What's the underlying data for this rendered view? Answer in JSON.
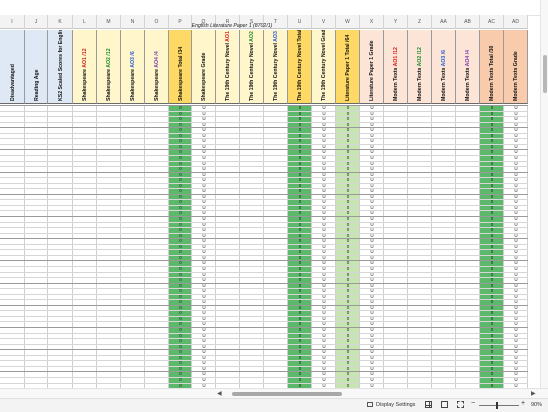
{
  "sheet_title": "English Literature Paper 1 (8702/1)",
  "columns": [
    {
      "letter": "I",
      "header": "Disadvantaged",
      "width": 25,
      "fill": "#dfe9f6",
      "parts": [
        {
          "t": "Disadvantaged",
          "c": ""
        }
      ]
    },
    {
      "letter": "J",
      "header": "Reading Age",
      "width": 23,
      "fill": "#dfe9f6",
      "parts": [
        {
          "t": "Reading Age",
          "c": ""
        }
      ]
    },
    {
      "letter": "K",
      "header": "KS2 Scaled Scores for English and Maths",
      "width": 25,
      "fill": "#dfe9f6",
      "parts": [
        {
          "t": "KS2 Scaled Scores for English",
          "c": ""
        },
        {
          "t": " and Maths",
          "c": ""
        }
      ]
    },
    {
      "letter": "L",
      "header": "Shakespeare AO1 /12",
      "width": 24,
      "fill": "#fff6cc",
      "parts": [
        {
          "t": "Shakespeare ",
          "c": ""
        },
        {
          "t": "AO1 /12",
          "c": "red"
        }
      ]
    },
    {
      "letter": "M",
      "header": "Shakespeare AO2 /12",
      "width": 24,
      "fill": "#fff6cc",
      "parts": [
        {
          "t": "Shakespeare ",
          "c": ""
        },
        {
          "t": "AO2 /12",
          "c": "green"
        }
      ]
    },
    {
      "letter": "N",
      "header": "Shakespeare AO3 /6",
      "width": 24,
      "fill": "#fff6cc",
      "parts": [
        {
          "t": "Shakespeare ",
          "c": ""
        },
        {
          "t": "AO3 /6",
          "c": "blue"
        }
      ]
    },
    {
      "letter": "O",
      "header": "Shakespeare AO4 /4",
      "width": 24,
      "fill": "#fff6cc",
      "parts": [
        {
          "t": "Shakespeare ",
          "c": ""
        },
        {
          "t": "AO4 /4",
          "c": "purple"
        }
      ]
    },
    {
      "letter": "P",
      "header": "Shakespeare Total /34",
      "width": 23,
      "fill": "#ffd966",
      "band": "#5cb86a",
      "parts": [
        {
          "t": "Shakespeare Total /34",
          "c": ""
        }
      ]
    },
    {
      "letter": "Q",
      "header": "Shakespeare Grade",
      "width": 24,
      "fill": "#fff6cc",
      "parts": [
        {
          "t": "Shakespeare Grade",
          "c": ""
        }
      ]
    },
    {
      "letter": "R",
      "header": "The 19th Century Novel AO1 /12",
      "width": 24,
      "fill": "#fff6cc",
      "parts": [
        {
          "t": "The 19th Century Novel ",
          "c": ""
        },
        {
          "t": "AO1 /12",
          "c": "red"
        }
      ]
    },
    {
      "letter": "S",
      "header": "The 19th Century Novel AO2 /12",
      "width": 24,
      "fill": "#fff6cc",
      "parts": [
        {
          "t": "The 19th Century Novel ",
          "c": ""
        },
        {
          "t": "AO2 /12",
          "c": "green"
        }
      ]
    },
    {
      "letter": "T",
      "header": "The 19th Century Novel AO3 /6",
      "width": 24,
      "fill": "#fff6cc",
      "parts": [
        {
          "t": "The 19th Century Novel ",
          "c": ""
        },
        {
          "t": "AO3 /6",
          "c": "blue"
        }
      ]
    },
    {
      "letter": "U",
      "header": "The 19th Century Novel Total /30",
      "width": 24,
      "fill": "#ffd966",
      "band": "#5cb86a",
      "parts": [
        {
          "t": "The 19th Century Novel",
          "c": ""
        },
        {
          "t": " Total /30",
          "c": ""
        }
      ]
    },
    {
      "letter": "V",
      "header": "The 19th Century Novel Grade",
      "width": 24,
      "fill": "#fff6cc",
      "parts": [
        {
          "t": "The 19th Century Novel",
          "c": ""
        },
        {
          "t": " Grade",
          "c": ""
        }
      ]
    },
    {
      "letter": "W",
      "header": "Literature Paper 1 Total /64",
      "width": 24,
      "fill": "#ffd966",
      "band": "#c7e5b3",
      "parts": [
        {
          "t": "Literature Paper 1 Total",
          "c": ""
        },
        {
          "t": " /64",
          "c": ""
        }
      ]
    },
    {
      "letter": "X",
      "header": "Literature Paper 1 Grade",
      "width": 24,
      "fill": "#fce4d6",
      "parts": [
        {
          "t": "Literature Paper 1 Grade",
          "c": ""
        }
      ]
    },
    {
      "letter": "Y",
      "header": "Modern Texts AO1 /12",
      "width": 24,
      "fill": "#fce4d6",
      "parts": [
        {
          "t": "Modern Texts ",
          "c": ""
        },
        {
          "t": "AO1 /12",
          "c": "red"
        }
      ]
    },
    {
      "letter": "Z",
      "header": "Modern Texts AO2 /12",
      "width": 24,
      "fill": "#fce4d6",
      "parts": [
        {
          "t": "Modern Texts ",
          "c": ""
        },
        {
          "t": "AO2 /12",
          "c": "green"
        }
      ]
    },
    {
      "letter": "AA",
      "header": "Modern Texts AO3 /6",
      "width": 24,
      "fill": "#fce4d6",
      "parts": [
        {
          "t": "Modern Texts ",
          "c": ""
        },
        {
          "t": "AO3 /6",
          "c": "blue"
        }
      ]
    },
    {
      "letter": "AB",
      "header": "Modern Texts AO4 /4",
      "width": 24,
      "fill": "#fce4d6",
      "parts": [
        {
          "t": "Modern Texts ",
          "c": ""
        },
        {
          "t": "AO4 /4",
          "c": "purple"
        }
      ]
    },
    {
      "letter": "AC",
      "header": "Modern Texts Total /30",
      "width": 24,
      "fill": "#f8cbad",
      "band": "#5cb86a",
      "parts": [
        {
          "t": "Modern Texts Total /30",
          "c": ""
        }
      ]
    },
    {
      "letter": "AD",
      "header": "Modern Texts Grade",
      "width": 24,
      "fill": "#f8cbad",
      "parts": [
        {
          "t": "Modern Texts Grade",
          "c": ""
        }
      ]
    }
  ],
  "zero_value": "0",
  "u_value": "U",
  "zero_columns": [
    "P",
    "U",
    "W",
    "AC"
  ],
  "u_columns": [
    "Q",
    "V",
    "X",
    "AD"
  ],
  "status": {
    "display_settings": "Display Settings",
    "zoom": "90%"
  },
  "colors": {
    "header_gray": "#f3f3f3",
    "green_band": "#5cb86a",
    "light_green_band": "#c7e5b3"
  }
}
